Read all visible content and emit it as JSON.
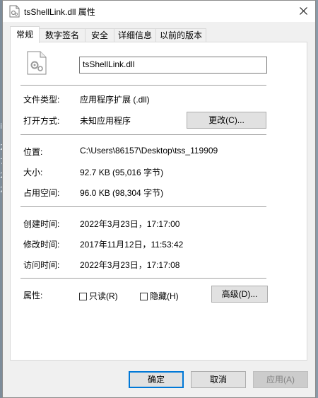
{
  "window": {
    "title": "tsShellLink.dll 属性"
  },
  "tabs": [
    {
      "label": "常规"
    },
    {
      "label": "数字签名"
    },
    {
      "label": "安全"
    },
    {
      "label": "详细信息"
    },
    {
      "label": "以前的版本"
    }
  ],
  "general": {
    "file_name": "tsShellLink.dll",
    "file_type_label": "文件类型:",
    "file_type_value": "应用程序扩展 (.dll)",
    "open_with_label": "打开方式:",
    "open_with_value": "未知应用程序",
    "change_button": "更改(C)...",
    "location_label": "位置:",
    "location_value": "C:\\Users\\86157\\Desktop\\tss_119909",
    "size_label": "大小:",
    "size_value": "92.7 KB (95,016 字节)",
    "size_on_disk_label": "占用空间:",
    "size_on_disk_value": "96.0 KB (98,304 字节)",
    "created_label": "创建时间:",
    "created_value": "2022年3月23日，17:17:00",
    "modified_label": "修改时间:",
    "modified_value": "2017年11月12日，11:53:42",
    "accessed_label": "访问时间:",
    "accessed_value": "2022年3月23日，17:17:08",
    "attributes_label": "属性:",
    "readonly_label": "只读(R)",
    "hidden_label": "隐藏(H)",
    "advanced_button": "高级(D)..."
  },
  "footer": {
    "ok": "确定",
    "cancel": "取消",
    "apply": "应用(A)"
  },
  "background_text": [
    "iz",
    "2",
    "7",
    "2",
    "2"
  ]
}
